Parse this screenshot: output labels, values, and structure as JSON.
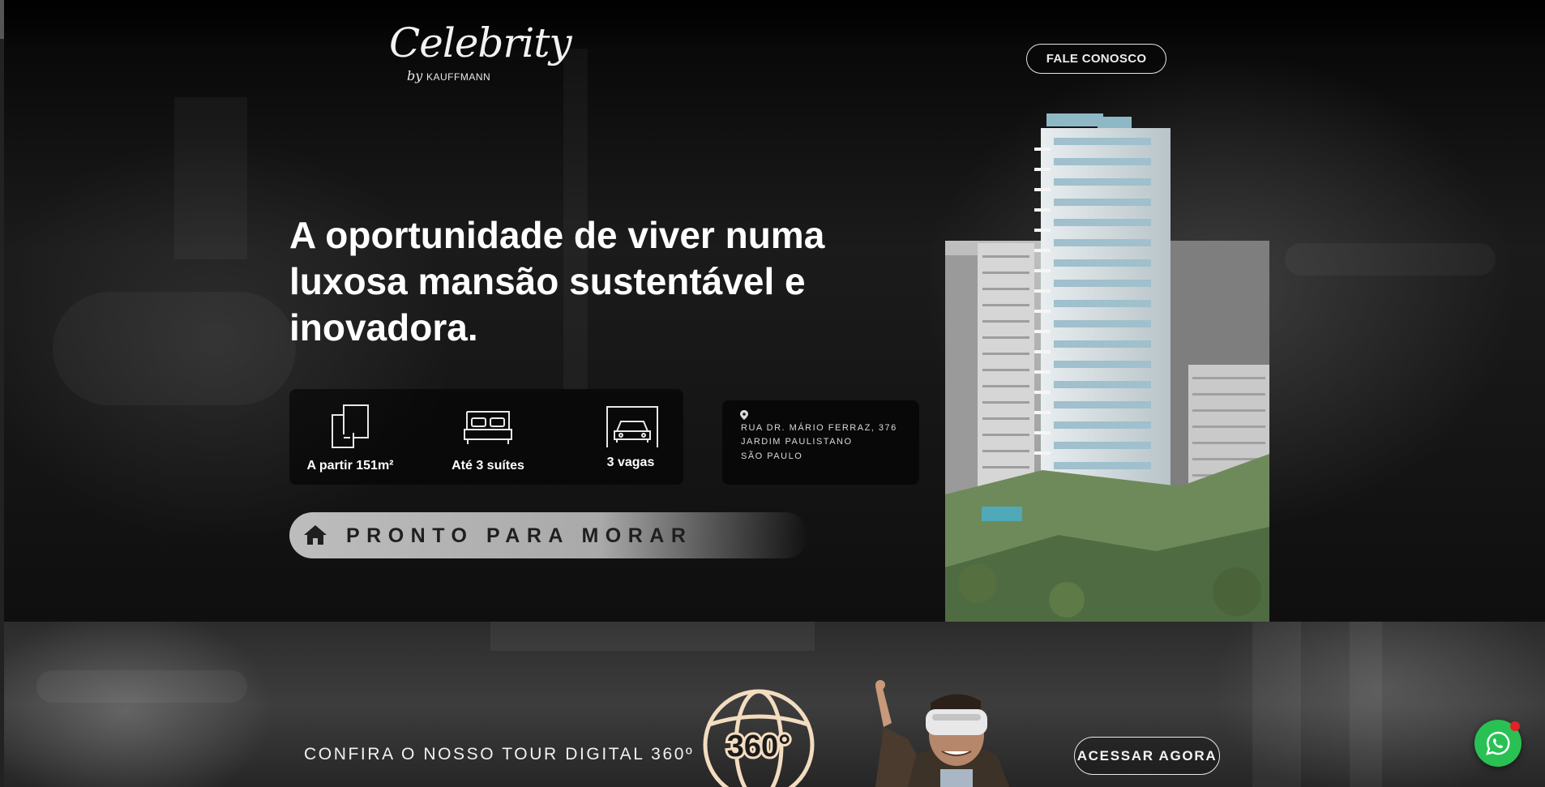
{
  "header": {
    "logo_script": "Celebrity",
    "logo_by": "by",
    "logo_brand": "KAUFFMANN",
    "contact_label": "FALE CONOSCO"
  },
  "hero": {
    "headline": "A oportunidade de viver numa luxosa mansão sustentável e inovadora.",
    "features": [
      {
        "icon": "floor-plan-icon",
        "label": "A partir 151m²"
      },
      {
        "icon": "bed-icon",
        "label": "Até 3 suítes"
      },
      {
        "icon": "car-icon",
        "label": "3 vagas"
      }
    ],
    "address": {
      "icon": "location-pin-icon",
      "line1": "RUA DR. MÁRIO FERRAZ, 376",
      "line2": "JARDIM PAULISTANO",
      "line3": "SÃO PAULO"
    },
    "status_label": "PRONTO PARA MORAR"
  },
  "tour": {
    "text": "CONFIRA O NOSSO TOUR DIGITAL 360º",
    "badge": "360°",
    "button_label": "ACESSAR AGORA"
  },
  "widgets": {
    "whatsapp_icon": "whatsapp-icon"
  },
  "colors": {
    "accent_cream": "#f3dcc0",
    "whatsapp_green": "#2ac154",
    "notification_red": "#e02424"
  }
}
